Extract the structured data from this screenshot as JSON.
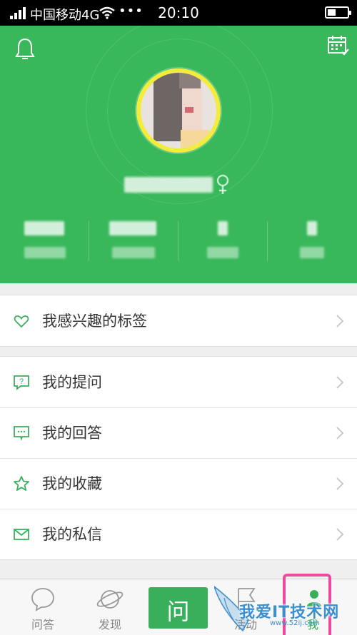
{
  "status_bar": {
    "carrier": "中国移动4G",
    "dots": "•••",
    "time": "20:10"
  },
  "profile": {
    "gender_symbol": "♀"
  },
  "menu": {
    "interest_tags": "我感兴趣的标签",
    "items": [
      {
        "label": "我的提问"
      },
      {
        "label": "我的回答"
      },
      {
        "label": "我的收藏"
      },
      {
        "label": "我的私信"
      }
    ]
  },
  "tabbar": {
    "qa": "问答",
    "discover": "发现",
    "ask": "问",
    "activity": "活动",
    "me": "我"
  },
  "watermark": {
    "text": "我爱IT技术网",
    "url": "www.52ij.com"
  },
  "colors": {
    "brand_green": "#38b85a",
    "icon_green": "#3aaf5b",
    "highlight_mark": "#ec4aa0"
  }
}
